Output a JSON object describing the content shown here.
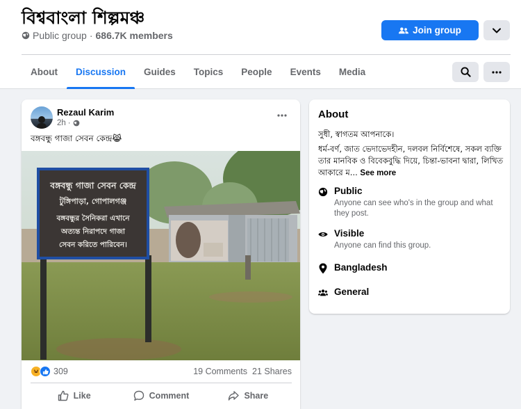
{
  "group": {
    "title": "বিশ্ববাংলা শিল্পমঞ্চ",
    "privacy": "Public group",
    "separator": "·",
    "members": "686.7K members",
    "join_label": "Join group"
  },
  "tabs": [
    "About",
    "Discussion",
    "Guides",
    "Topics",
    "People",
    "Events",
    "Media"
  ],
  "active_tab": "Discussion",
  "post": {
    "author": "Rezaul Karim",
    "time": "2h",
    "text": "বঙ্গবন্ধু গাজা সেবন কেন্দ্র😹",
    "photo_sign": {
      "line1": "বঙ্গবন্ধু গাজা সেবন কেন্দ্র",
      "line2": "টুঙ্গিপাড়া, গোপালগঞ্জ",
      "line3": "বঙ্গবন্ধুর সৈনিকরা এখানে",
      "line4": "অত্যন্ত নিরাপদে গাজা",
      "line5": "সেবন করিতে পারিবেন।"
    },
    "reaction_count": "309",
    "comments": "19 Comments",
    "shares": "21 Shares",
    "like_label": "Like",
    "comment_label": "Comment",
    "share_label": "Share"
  },
  "about": {
    "title": "About",
    "greeting": "সুধী, স্বাগতম আপনাকে।",
    "description": "ধর্ম-বর্ণ, জাত ভেদাভেদহীন, দলবল নির্বিশেষে, সকল ব্যক্তি তার মানবিক ও বিবেকবুদ্ধি দিয়ে, চিন্তা-ভাবনা দ্বারা, লিখিত আকারে ম...",
    "see_more": "See more",
    "public_title": "Public",
    "public_desc": "Anyone can see who's in the group and what they post.",
    "visible_title": "Visible",
    "visible_desc": "Anyone can find this group.",
    "location": "Bangladesh",
    "category": "General"
  },
  "colors": {
    "accent": "#1877f2",
    "background": "#f0f2f5",
    "secondary_text": "#65676b"
  },
  "icons": [
    "globe-icon",
    "join-people-icon",
    "chevron-down-icon",
    "search-icon",
    "more-icon",
    "like-icon",
    "comment-icon",
    "share-icon",
    "eye-icon",
    "location-icon",
    "group-icon"
  ]
}
